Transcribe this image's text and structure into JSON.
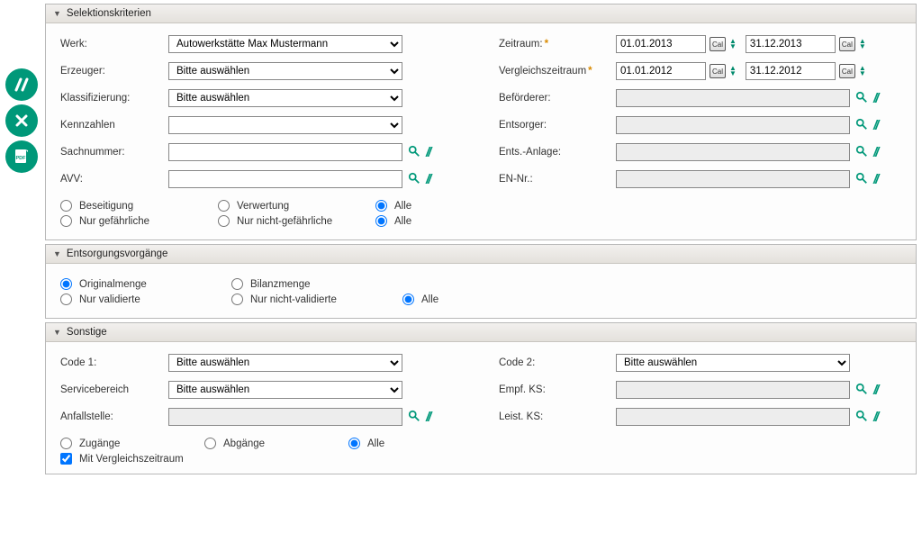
{
  "side": {
    "icon1_name": "action-slash-icon",
    "icon2_name": "excel-export-icon",
    "icon3_name": "pdf-export-icon"
  },
  "panel1": {
    "title": "Selektionskriterien",
    "werk_label": "Werk:",
    "werk_value": "Autowerkstätte Max Mustermann",
    "erzeuger_label": "Erzeuger:",
    "erzeuger_value": "Bitte auswählen",
    "klass_label": "Klassifizierung:",
    "klass_value": "Bitte auswählen",
    "kennz_label": "Kennzahlen",
    "kennz_value": "",
    "sach_label": "Sachnummer:",
    "avv_label": "AVV:",
    "zeitraum_label": "Zeitraum:",
    "zeitraum_from": "01.01.2013",
    "zeitraum_to": "31.12.2013",
    "vzeitraum_label": "Vergleichszeitraum",
    "vzeitraum_from": "01.01.2012",
    "vzeitraum_to": "31.12.2012",
    "befoerderer_label": "Beförderer:",
    "entsorger_label": "Entsorger:",
    "entsanlage_label": "Ents.-Anlage:",
    "ennr_label": "EN-Nr.:",
    "r1_a": "Beseitigung",
    "r1_b": "Verwertung",
    "r1_c": "Alle",
    "r2_a": "Nur gefährliche",
    "r2_b": "Nur nicht-gefährliche",
    "r2_c": "Alle"
  },
  "panel2": {
    "title": "Entsorgungsvorgänge",
    "r1_a": "Originalmenge",
    "r1_b": "Bilanzmenge",
    "r2_a": "Nur validierte",
    "r2_b": "Nur nicht-validierte",
    "r2_c": "Alle"
  },
  "panel3": {
    "title": "Sonstige",
    "code1_label": "Code 1:",
    "code1_value": "Bitte auswählen",
    "code2_label": "Code 2:",
    "code2_value": "Bitte auswählen",
    "service_label": "Servicebereich",
    "service_value": "Bitte auswählen",
    "empfks_label": "Empf. KS:",
    "anfall_label": "Anfallstelle:",
    "leistks_label": "Leist. KS:",
    "r_a": "Zugänge",
    "r_b": "Abgänge",
    "r_c": "Alle",
    "chk": "Mit Vergleichszeitraum"
  }
}
